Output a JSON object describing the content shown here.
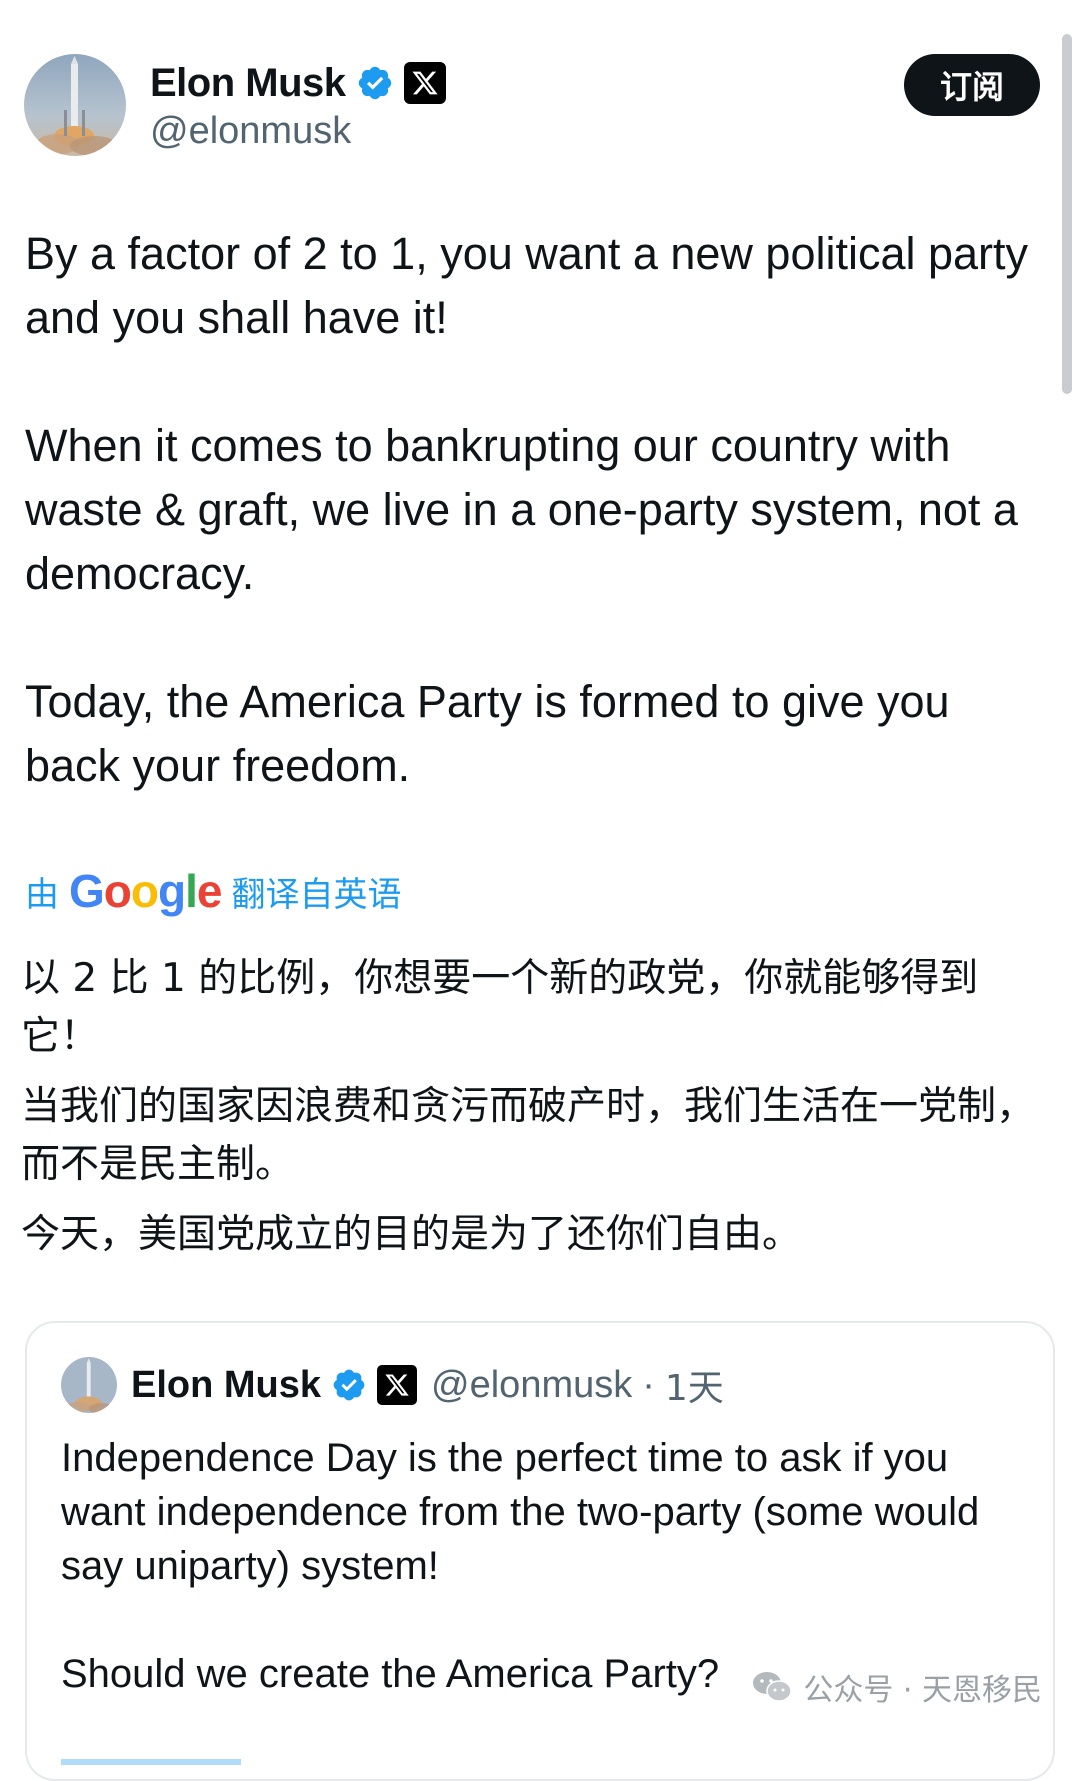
{
  "header": {
    "display_name": "Elon Musk",
    "handle": "@elonmusk",
    "subscribe_label": "订阅"
  },
  "icons": {
    "avatar": "rocket-launch-avatar",
    "verified": "verified-badge-icon",
    "affiliation": "x-logo-icon",
    "watermark": "wechat-icon"
  },
  "colors": {
    "verified_blue": "#1d9bf0",
    "text_primary": "#0f1419",
    "text_secondary": "#536471",
    "button_bg": "#0f1419"
  },
  "tweet": {
    "paragraphs": [
      "By a factor of 2 to 1, you want a new political party and you shall have it!",
      "When it comes to bankrupting our country with waste & graft, we live in a one-party system, not a democracy.",
      "Today, the America Party is formed to give you back your freedom."
    ]
  },
  "translation": {
    "prefix": "由",
    "provider": "Google",
    "suffix": "翻译自英语",
    "lines": [
      "以 2 比 1 的比例，你想要一个新的政党，你就能够得到它！",
      "当我们的国家因浪费和贪污而破产时，我们生活在一党制，而不是民主制。",
      "今天，美国党成立的目的是为了还你们自由。"
    ]
  },
  "quote": {
    "display_name": "Elon Musk",
    "handle": "@elonmusk",
    "separator": "·",
    "time": "1天",
    "paragraphs": [
      "Independence Day is the perfect time to ask if you want independence from the two-party (some would say uniparty) system!",
      "Should we create the America Party?"
    ]
  },
  "watermark": {
    "text": "公众号 · 天恩移民"
  }
}
